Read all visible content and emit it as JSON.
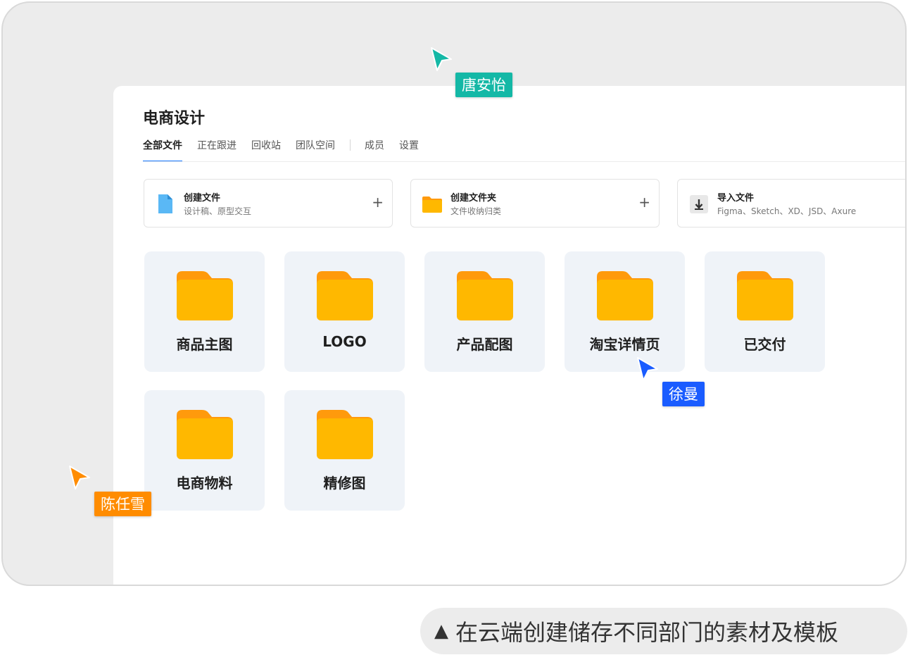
{
  "workspace": {
    "title": "电商设计"
  },
  "tabs": [
    {
      "label": "全部文件",
      "active": true
    },
    {
      "label": "正在跟进",
      "active": false
    },
    {
      "label": "回收站",
      "active": false
    },
    {
      "label": "团队空间",
      "active": false
    },
    {
      "label": "成员",
      "active": false
    },
    {
      "label": "设置",
      "active": false
    }
  ],
  "actions": [
    {
      "title": "创建文件",
      "desc": "设计稿、原型交互",
      "icon": "file-icon",
      "plus": "+"
    },
    {
      "title": "创建文件夹",
      "desc": "文件收纳归类",
      "icon": "folder-icon",
      "plus": "+"
    },
    {
      "title": "导入文件",
      "desc": "Figma、Sketch、XD、JSD、Axure",
      "icon": "import-icon",
      "plus": "+"
    }
  ],
  "folders": [
    {
      "label": "商品主图"
    },
    {
      "label": "LOGO"
    },
    {
      "label": "产品配图"
    },
    {
      "label": "淘宝详情页"
    },
    {
      "label": "已交付"
    },
    {
      "label": "电商物料"
    },
    {
      "label": "精修图"
    }
  ],
  "collaborators": [
    {
      "name": "唐安怡",
      "color": "#14b8a6"
    },
    {
      "name": "徐曼",
      "color": "#1a5cff"
    },
    {
      "name": "陈任雪",
      "color": "#ff8c00"
    }
  ],
  "colors": {
    "folder_body": "#ffb800",
    "folder_tab": "#ff9a0c",
    "accent": "#1677ff"
  },
  "caption": {
    "marker": "▲",
    "text": "在云端创建储存不同部门的素材及模板"
  }
}
